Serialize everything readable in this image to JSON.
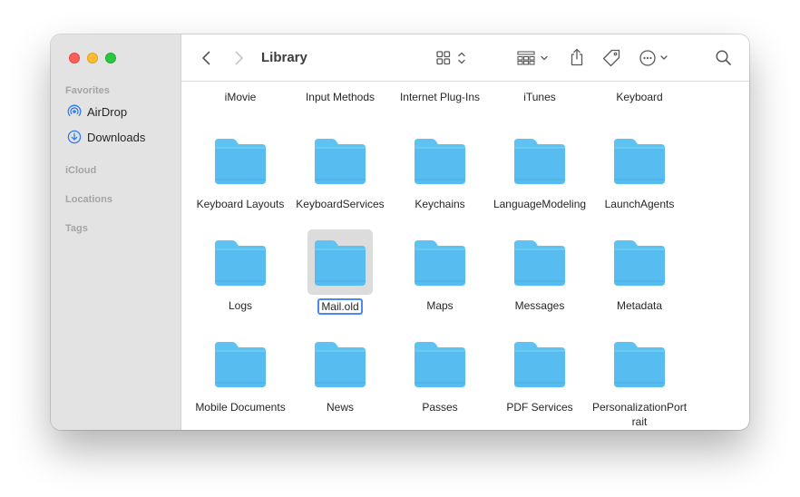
{
  "window": {
    "title": "Library"
  },
  "sidebar": {
    "sections": {
      "favorites": "Favorites",
      "icloud": "iCloud",
      "locations": "Locations",
      "tags": "Tags"
    },
    "items": [
      {
        "label": "AirDrop",
        "icon": "airdrop-icon"
      },
      {
        "label": "Downloads",
        "icon": "download-icon"
      }
    ]
  },
  "top_row": [
    "iMovie",
    "Input Methods",
    "Internet Plug-Ins",
    "iTunes",
    "Keyboard"
  ],
  "folders": [
    {
      "label": "Keyboard Layouts"
    },
    {
      "label": "KeyboardServices"
    },
    {
      "label": "Keychains"
    },
    {
      "label": "LanguageModeling"
    },
    {
      "label": "LaunchAgents"
    },
    {
      "label": "Logs"
    },
    {
      "label": "Mail.old",
      "selected": true,
      "editing": true
    },
    {
      "label": "Maps"
    },
    {
      "label": "Messages"
    },
    {
      "label": "Metadata"
    },
    {
      "label": "Mobile Documents"
    },
    {
      "label": "News"
    },
    {
      "label": "Passes"
    },
    {
      "label": "PDF Services"
    },
    {
      "label": "PersonalizationPortrait"
    }
  ],
  "colors": {
    "folder_top": "#5ec3f2",
    "folder_body": "#57bdf0",
    "selection": "#dcdcdc",
    "rename_border": "#4d88ee"
  }
}
